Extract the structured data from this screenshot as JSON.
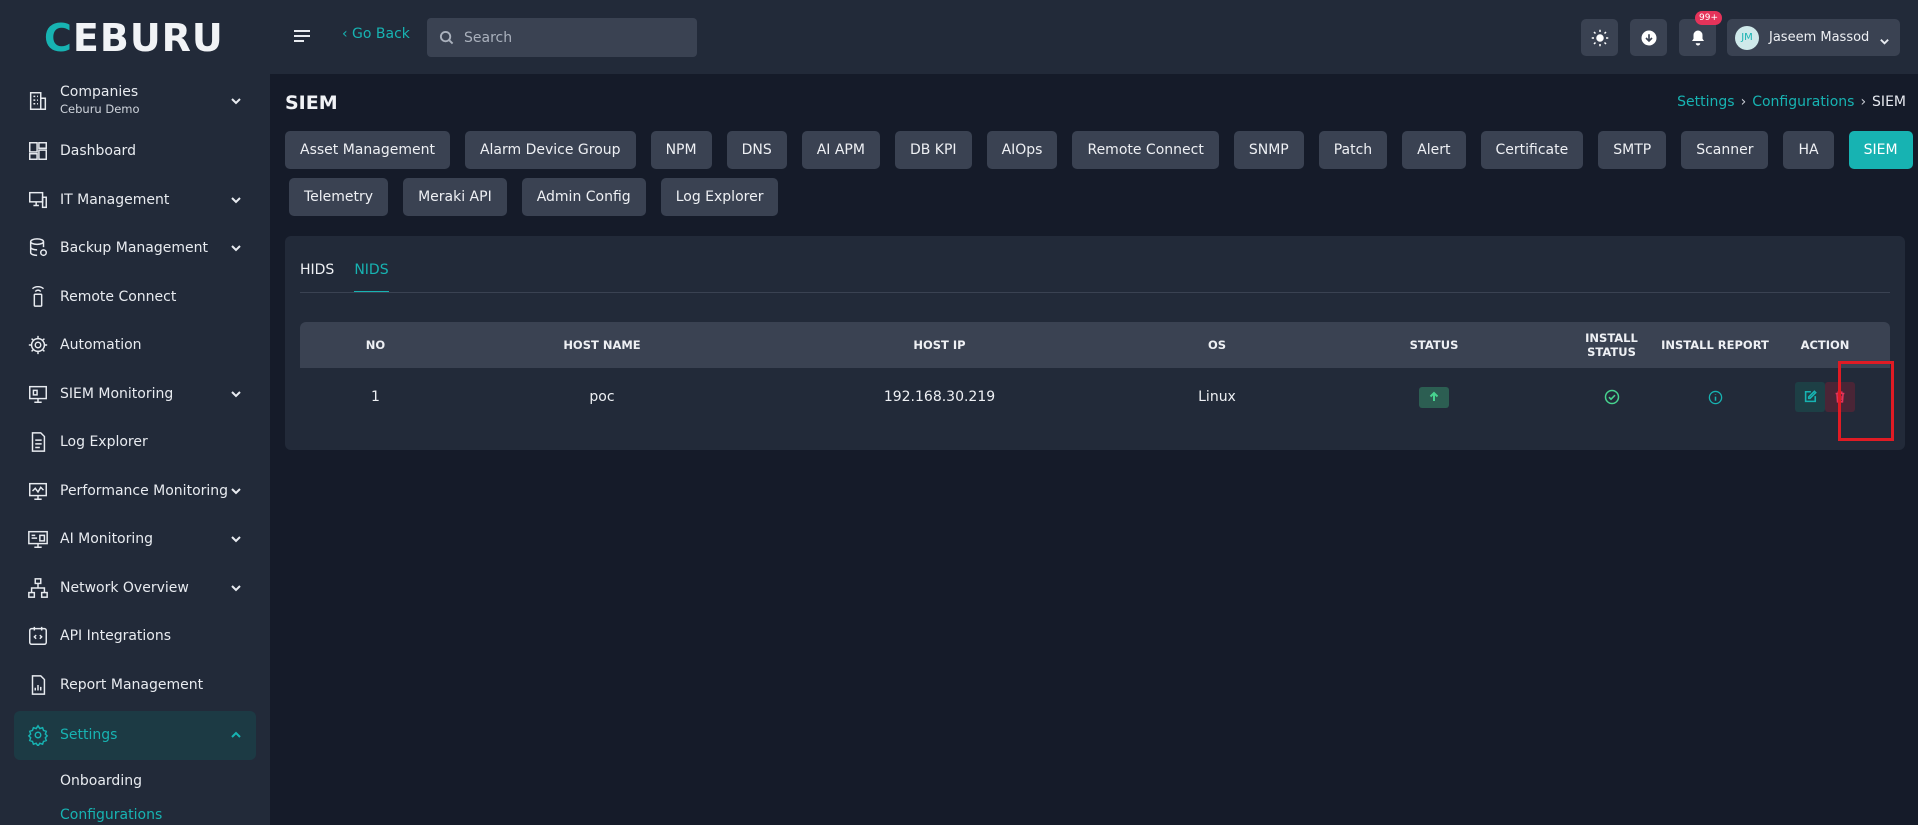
{
  "brand": {
    "logo_text": "CEBURU",
    "accent": "#17b3b2"
  },
  "sidebar": {
    "items": [
      {
        "label": "Companies",
        "sub": "Ceburu Demo",
        "icon": "building-icon",
        "expandable": true
      },
      {
        "label": "Dashboard",
        "icon": "dashboard-icon",
        "expandable": false
      },
      {
        "label": "IT Management",
        "icon": "it-management-icon",
        "expandable": true
      },
      {
        "label": "Backup Management",
        "icon": "database-icon",
        "expandable": true
      },
      {
        "label": "Remote Connect",
        "icon": "remote-icon",
        "expandable": false
      },
      {
        "label": "Automation",
        "icon": "gear-cycle-icon",
        "expandable": false
      },
      {
        "label": "SIEM Monitoring",
        "icon": "monitor-icon",
        "expandable": true
      },
      {
        "label": "Log Explorer",
        "icon": "document-icon",
        "expandable": false
      },
      {
        "label": "Performance Monitoring",
        "icon": "performance-icon",
        "expandable": true
      },
      {
        "label": "AI Monitoring",
        "icon": "ai-monitor-icon",
        "expandable": true
      },
      {
        "label": "Network Overview",
        "icon": "network-icon",
        "expandable": true
      },
      {
        "label": "API Integrations",
        "icon": "api-icon",
        "expandable": false
      },
      {
        "label": "Report Management",
        "icon": "report-icon",
        "expandable": false
      },
      {
        "label": "Settings",
        "icon": "settings-icon",
        "expandable": true,
        "active": true
      }
    ],
    "settings_sub": [
      "Onboarding",
      "Configurations"
    ]
  },
  "topbar": {
    "go_back": "‹ Go Back",
    "search_placeholder": "Search",
    "notification_badge": "99+",
    "user_initials": "JM",
    "user_name": "Jaseem Massod"
  },
  "page": {
    "title": "SIEM",
    "breadcrumb": [
      "Settings",
      "Configurations",
      "SIEM"
    ]
  },
  "config_tabs": {
    "row1": [
      "Asset Management",
      "Alarm Device Group",
      "NPM",
      "DNS",
      "AI APM",
      "DB KPI",
      "AIOps",
      "Remote Connect",
      "SNMP",
      "Patch",
      "Alert",
      "Certificate",
      "SMTP",
      "Scanner",
      "HA",
      "SIEM"
    ],
    "row2": [
      "Telemetry",
      "Meraki API",
      "Admin Config",
      "Log Explorer"
    ],
    "active": "SIEM"
  },
  "subtabs": {
    "items": [
      "HIDS",
      "NIDS"
    ],
    "active": "NIDS"
  },
  "table": {
    "headers": [
      "NO",
      "HOST NAME",
      "HOST IP",
      "OS",
      "STATUS",
      "INSTALL STATUS",
      "INSTALL REPORT",
      "ACTION"
    ],
    "rows": [
      {
        "no": "1",
        "host_name": "poc",
        "host_ip": "192.168.30.219",
        "os": "Linux",
        "status": "up",
        "install_status": "success",
        "install_report": "info"
      }
    ]
  }
}
